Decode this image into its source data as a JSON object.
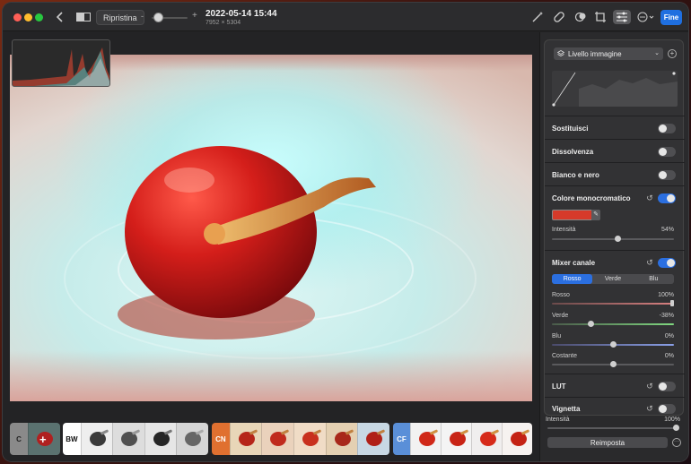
{
  "toolbar": {
    "reset_label": "Ripristina",
    "zoom_minus": "-",
    "zoom_plus": "+",
    "title": "2022-05-14 15:44",
    "subtitle": "7952 × 5304",
    "done_label": "Fine",
    "back_icon": "chevron-left-icon",
    "icons": [
      "magic-wand-icon",
      "bandage-icon",
      "filter-icon",
      "crop-icon",
      "adjust-icon",
      "more-icon"
    ]
  },
  "panel": {
    "layer_label": "Livello immagine",
    "sections": {
      "replace": "Sostituisci",
      "fade": "Dissolvenza",
      "bw": "Bianco e nero",
      "mono": "Colore monocromatico",
      "mixer": "Mixer canale",
      "lut": "LUT",
      "vignette": "Vignetta"
    },
    "mono_color": "#d63a2a",
    "mono_intensity_label": "Intensità",
    "mono_intensity_value": "54%",
    "mono_intensity_level": 0.54,
    "mixer_tabs": [
      "Rosso",
      "Verde",
      "Blu"
    ],
    "mixer_rows": [
      {
        "label": "Rosso",
        "value": "100%"
      },
      {
        "label": "Verde",
        "value": "-38%"
      },
      {
        "label": "Blu",
        "value": "0%"
      },
      {
        "label": "Costante",
        "value": "0%"
      }
    ],
    "vignette_intensity_label": "Intensità",
    "vignette_intensity_value": "100%",
    "reset_button": "Reimposta"
  },
  "filmstrip": {
    "groups": [
      {
        "label": "C",
        "color": "#8a8a8a"
      },
      {
        "label": "BW",
        "color": "#ffffff"
      },
      {
        "label": "CN",
        "color": "#e07030"
      },
      {
        "label": "CF",
        "color": "#5a8fd8"
      }
    ]
  },
  "colors": {
    "accent": "#2b6fe0",
    "done_button": "#1f6fe0",
    "cherry_red": "#c8201c"
  }
}
